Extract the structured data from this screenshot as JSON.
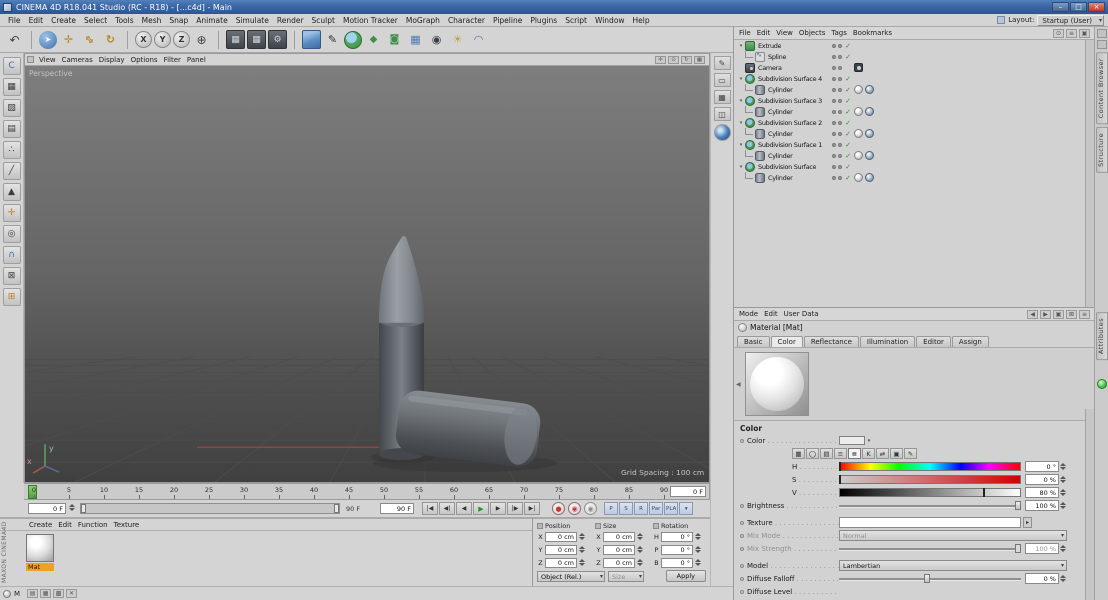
{
  "window": {
    "title": "CINEMA 4D R18.041 Studio (RC - R18) - [...c4d] - Main",
    "minimize": "–",
    "maximize": "□",
    "close": "×"
  },
  "menubar": {
    "items": [
      "File",
      "Edit",
      "Create",
      "Select",
      "Tools",
      "Mesh",
      "Snap",
      "Animate",
      "Simulate",
      "Render",
      "Sculpt",
      "Motion Tracker",
      "MoGraph",
      "Character",
      "Pipeline",
      "Plugins",
      "Script",
      "Window",
      "Help"
    ],
    "layout_label": "Layout:",
    "layout_value": "Startup (User)"
  },
  "toolbar": {
    "buttons": [
      {
        "id": "undo-button",
        "glyph": "↶",
        "cls": "tb-plain"
      },
      {
        "sep": true
      },
      {
        "id": "live-selection-button",
        "glyph": "➤",
        "cls": "tb-sel"
      },
      {
        "id": "move-button",
        "glyph": "✛",
        "cls": "tb-gold"
      },
      {
        "id": "scale-button",
        "glyph": "⇔",
        "cls": "tb-gold rot45"
      },
      {
        "id": "rotate-button",
        "glyph": "↻",
        "cls": "tb-gold"
      },
      {
        "sep": true
      },
      {
        "id": "lock-x-axis-button",
        "glyph": "X",
        "cls": "tb-axis"
      },
      {
        "id": "lock-y-axis-button",
        "glyph": "Y",
        "cls": "tb-axis"
      },
      {
        "id": "lock-z-axis-button",
        "glyph": "Z",
        "cls": "tb-axis"
      },
      {
        "id": "coordinate-system-button",
        "glyph": "⊕",
        "cls": "tb-plain"
      },
      {
        "sep": true
      },
      {
        "id": "render-view-button",
        "glyph": "▦",
        "cls": "tb-dark"
      },
      {
        "id": "render-picture-viewer-button",
        "glyph": "▦",
        "cls": "tb-dark"
      },
      {
        "id": "render-settings-button",
        "glyph": "⚙",
        "cls": "tb-dark"
      },
      {
        "sep": true
      },
      {
        "id": "add-cube-button",
        "glyph": "",
        "cls": "tb-cube"
      },
      {
        "id": "add-spline-button",
        "glyph": "✎",
        "cls": "tb-pen"
      },
      {
        "id": "add-subdivision-surface-button",
        "glyph": "",
        "cls": "tb-sds"
      },
      {
        "id": "add-array-button",
        "glyph": "◆",
        "cls": "tb-green"
      },
      {
        "id": "add-boole-button",
        "glyph": "◙",
        "cls": "tb-green"
      },
      {
        "id": "add-floor-button",
        "glyph": "▦",
        "cls": "tb-blue"
      },
      {
        "id": "add-camera-button",
        "glyph": "◉",
        "cls": "tb-darkgray"
      },
      {
        "id": "add-light-button",
        "glyph": "☀",
        "cls": "tb-lightbtn"
      },
      {
        "id": "add-sky-button",
        "glyph": "◠",
        "cls": "tb-blue"
      }
    ]
  },
  "palette": {
    "buttons": [
      {
        "id": "make-editable-button",
        "glyph": "C",
        "cls": "p-blue"
      },
      {
        "id": "model-mode-button",
        "glyph": "▦",
        "cls": "p-gray"
      },
      {
        "id": "texture-mode-button",
        "glyph": "▨",
        "cls": "p-gray"
      },
      {
        "id": "workplane-mode-button",
        "glyph": "▤",
        "cls": "p-gray"
      },
      {
        "id": "points-mode-button",
        "glyph": "∴",
        "cls": "p-gray"
      },
      {
        "id": "edges-mode-button",
        "glyph": "╱",
        "cls": "p-gray"
      },
      {
        "id": "polygons-mode-button",
        "glyph": "▲",
        "cls": "p-gray"
      },
      {
        "id": "enable-axis-button",
        "glyph": "✛",
        "cls": "p-orange"
      },
      {
        "id": "viewport-solo-button",
        "glyph": "◎",
        "cls": "p-gray"
      },
      {
        "id": "snap-button",
        "glyph": "∩",
        "cls": "p-blue"
      },
      {
        "id": "locked-workplane-button",
        "glyph": "⊠",
        "cls": "p-gray"
      },
      {
        "id": "interactive-workplane-button",
        "glyph": "⊞",
        "cls": "p-orange"
      }
    ]
  },
  "side_strip": {
    "buttons": [
      {
        "id": "annotate-button",
        "glyph": "✎",
        "cls": "s-gray"
      },
      {
        "id": "film-button",
        "glyph": "▭",
        "cls": "s-gray"
      },
      {
        "id": "grid-button",
        "glyph": "▦",
        "cls": "s-gray"
      },
      {
        "id": "panel-button",
        "glyph": "◫",
        "cls": "s-gray"
      },
      {
        "id": "globe-button",
        "glyph": "",
        "cls": "s-globe"
      }
    ]
  },
  "viewport": {
    "menu": [
      "View",
      "Cameras",
      "Display",
      "Options",
      "Filter",
      "Panel"
    ],
    "label": "Perspective",
    "grid_spacing": "Grid Spacing : 100 cm",
    "axis_x": "x",
    "axis_y": "y",
    "corner_icons": [
      {
        "id": "pan-view-icon",
        "glyph": "✛"
      },
      {
        "id": "zoom-view-icon",
        "glyph": "⊙"
      },
      {
        "id": "rotate-view-icon",
        "glyph": "↻"
      },
      {
        "id": "toggle-view-icon",
        "glyph": "▦"
      }
    ]
  },
  "object_manager": {
    "menu": [
      "File",
      "Edit",
      "View",
      "Objects",
      "Tags",
      "Bookmarks"
    ],
    "header_icons": [
      {
        "id": "om-search-icon",
        "glyph": "⊙"
      },
      {
        "id": "om-filter-icon",
        "glyph": "≡"
      },
      {
        "id": "om-lock-icon",
        "glyph": "▣"
      }
    ],
    "items": [
      {
        "name": "Extrude",
        "level": 0,
        "type": "extrude",
        "parent": true,
        "check": true
      },
      {
        "name": "Spline",
        "level": 1,
        "type": "spline",
        "check": true
      },
      {
        "name": "Camera",
        "level": 0,
        "type": "camera",
        "tags": [
          "camera-toggle"
        ]
      },
      {
        "name": "Subdivision Surface 4",
        "level": 0,
        "type": "sds",
        "parent": true,
        "check": true
      },
      {
        "name": "Cylinder",
        "level": 1,
        "type": "cylinder",
        "check": true,
        "tags": [
          "texture-tag",
          "phong-tag"
        ]
      },
      {
        "name": "Subdivision Surface 3",
        "level": 0,
        "type": "sds",
        "parent": true,
        "check": true
      },
      {
        "name": "Cylinder",
        "level": 1,
        "type": "cylinder",
        "check": true,
        "tags": [
          "texture-tag",
          "phong-tag"
        ]
      },
      {
        "name": "Subdivision Surface 2",
        "level": 0,
        "type": "sds",
        "parent": true,
        "check": true
      },
      {
        "name": "Cylinder",
        "level": 1,
        "type": "cylinder",
        "check": true,
        "tags": [
          "texture-tag",
          "phong-tag"
        ]
      },
      {
        "name": "Subdivision Surface 1",
        "level": 0,
        "type": "sds",
        "parent": true,
        "check": true
      },
      {
        "name": "Cylinder",
        "level": 1,
        "type": "cylinder",
        "check": true,
        "tags": [
          "texture-tag",
          "phong-tag"
        ]
      },
      {
        "name": "Subdivision Surface",
        "level": 0,
        "type": "sds",
        "parent": true,
        "check": true
      },
      {
        "name": "Cylinder",
        "level": 1,
        "type": "cylinder",
        "check": true,
        "tags": [
          "texture-tag",
          "phong-tag"
        ]
      }
    ]
  },
  "attribute_manager": {
    "menu": [
      "Mode",
      "Edit",
      "User Data"
    ],
    "header_icons": [
      {
        "id": "history-back-icon",
        "glyph": "◀"
      },
      {
        "id": "history-forward-icon",
        "glyph": "▶"
      },
      {
        "id": "am-copy-icon",
        "glyph": "▣"
      },
      {
        "id": "am-lock-icon",
        "glyph": "⊠"
      },
      {
        "id": "am-config-icon",
        "glyph": "≡"
      }
    ],
    "title": "Material [Mat]",
    "tabs": [
      {
        "label": "Basic"
      },
      {
        "label": "Color",
        "active": true
      },
      {
        "label": "Reflectance"
      },
      {
        "label": "Illumination"
      },
      {
        "label": "Editor"
      },
      {
        "label": "Assign"
      }
    ],
    "section_title": "Color",
    "color_modes": [
      {
        "id": "compact-mode-icon",
        "glyph": "▦"
      },
      {
        "id": "wheel-mode-icon",
        "glyph": "◯"
      },
      {
        "id": "spectrum-mode-icon",
        "glyph": "▤"
      },
      {
        "id": "rgb-mode-icon",
        "glyph": "≡"
      },
      {
        "id": "hsv-mode-icon",
        "glyph": "≣",
        "active": true
      },
      {
        "id": "kelvin-mode-icon",
        "glyph": "K"
      },
      {
        "id": "mixer-mode-icon",
        "glyph": "⇄"
      },
      {
        "id": "swatch-mode-icon",
        "glyph": "▣"
      },
      {
        "id": "color-picker-icon",
        "glyph": "✎"
      }
    ],
    "params": {
      "color_label": "Color",
      "h_label": "H",
      "h_value": "0 °",
      "s_label": "S",
      "s_value": "0 %",
      "v_label": "V",
      "v_value": "80 %",
      "brightness_label": "Brightness",
      "brightness_value": "100 %",
      "texture_label": "Texture",
      "mix_mode_label": "Mix Mode",
      "mix_mode_value": "Normal",
      "mix_strength_label": "Mix Strength",
      "mix_strength_value": "100 %",
      "model_label": "Model",
      "model_value": "Lambertian",
      "diffuse_falloff_label": "Diffuse Falloff",
      "diffuse_falloff_value": "0 %",
      "diffuse_level_label": "Diffuse Level"
    },
    "slider_positions": {
      "h": 0,
      "s": 0,
      "v": 80,
      "brightness": 100,
      "mix_strength": 100,
      "diffuse_falloff": 50
    }
  },
  "timeline": {
    "ticks": [
      "0",
      "5",
      "10",
      "15",
      "20",
      "25",
      "30",
      "35",
      "40",
      "45",
      "50",
      "55",
      "60",
      "65",
      "70",
      "75",
      "80",
      "85",
      "90"
    ],
    "ruler_field": "0 F",
    "current_frame": "0 F",
    "range_end": "90 F",
    "doc_end": "90 F",
    "transport": [
      {
        "id": "goto-start-button",
        "glyph": "|◀"
      },
      {
        "id": "prev-key-button",
        "glyph": "◀|"
      },
      {
        "id": "prev-frame-button",
        "glyph": "◀"
      },
      {
        "id": "play-button",
        "glyph": "▶",
        "cls": "play"
      },
      {
        "id": "next-frame-button",
        "glyph": "▶"
      },
      {
        "id": "next-key-button",
        "glyph": "|▶"
      },
      {
        "id": "goto-end-button",
        "glyph": "▶|"
      }
    ],
    "record_buttons": [
      {
        "id": "record-keyframe-button",
        "glyph": "●",
        "cls": "rec"
      },
      {
        "id": "autokey-button",
        "glyph": "◉",
        "cls": "rec"
      },
      {
        "id": "keyframe-selection-button",
        "glyph": "◉",
        "cls": "rec2"
      }
    ],
    "key_toggles": [
      {
        "id": "key-position-toggle",
        "glyph": "P"
      },
      {
        "id": "key-scale-toggle",
        "glyph": "S"
      },
      {
        "id": "key-rotation-toggle",
        "glyph": "R"
      },
      {
        "id": "key-parameter-toggle",
        "glyph": "Par"
      },
      {
        "id": "key-pla-toggle",
        "glyph": "PLA"
      },
      {
        "id": "playback-options-button",
        "glyph": "▾"
      }
    ]
  },
  "material_manager": {
    "menu": [
      "Create",
      "Edit",
      "Function",
      "Texture"
    ],
    "materials": [
      {
        "name": "Mat"
      }
    ]
  },
  "coordinates": {
    "groups": [
      {
        "label": "Position",
        "rows": [
          {
            "k": "X",
            "v": "0 cm"
          },
          {
            "k": "Y",
            "v": "0 cm"
          },
          {
            "k": "Z",
            "v": "0 cm"
          }
        ]
      },
      {
        "label": "Size",
        "rows": [
          {
            "k": "X",
            "v": "0 cm"
          },
          {
            "k": "Y",
            "v": "0 cm"
          },
          {
            "k": "Z",
            "v": "0 cm"
          }
        ]
      },
      {
        "label": "Rotation",
        "rows": [
          {
            "k": "H",
            "v": "0 °"
          },
          {
            "k": "P",
            "v": "0 °"
          },
          {
            "k": "B",
            "v": "0 °"
          }
        ]
      }
    ],
    "mode_value": "Object (Rel.)",
    "size_mode_value": "Size",
    "apply_label": "Apply"
  },
  "right_dock": {
    "upper_tabs": [
      "Content Browser",
      "Structure"
    ],
    "lower_tabs": [
      "Attributes"
    ]
  },
  "branding": "MAXON CINEMA4D",
  "statusbar": {
    "label": "M",
    "icons": [
      {
        "id": "status-doc-icon",
        "glyph": "▤"
      },
      {
        "id": "status-folder-icon",
        "glyph": "▦"
      },
      {
        "id": "status-grid-icon",
        "glyph": "▩"
      },
      {
        "id": "status-close-icon",
        "glyph": "✕"
      }
    ]
  }
}
